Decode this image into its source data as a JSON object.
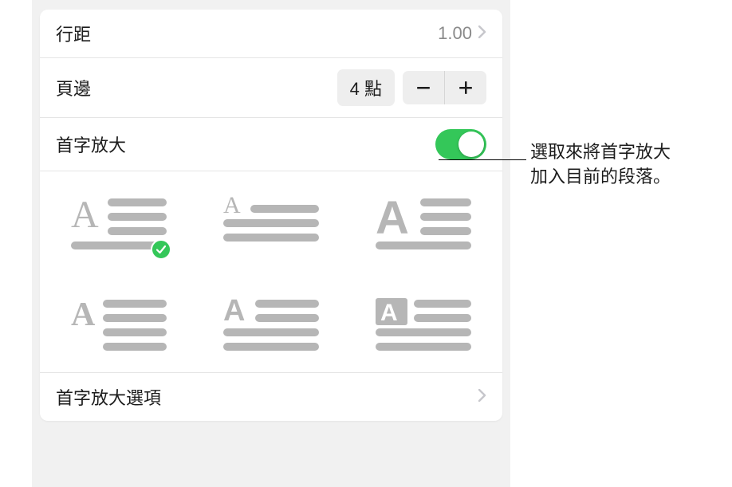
{
  "line_spacing": {
    "label": "行距",
    "value": "1.00"
  },
  "margin": {
    "label": "頁邊",
    "value": "4 點"
  },
  "dropcap": {
    "label": "首字放大",
    "enabled": true
  },
  "styles": {
    "selected_index": 0,
    "options": [
      {
        "name": "dropcap-style-1"
      },
      {
        "name": "dropcap-style-2"
      },
      {
        "name": "dropcap-style-3"
      },
      {
        "name": "dropcap-style-4"
      },
      {
        "name": "dropcap-style-5"
      },
      {
        "name": "dropcap-style-6"
      }
    ]
  },
  "dropcap_options": {
    "label": "首字放大選項"
  },
  "callout": {
    "line1": "選取來將首字放大",
    "line2": "加入目前的段落。"
  }
}
